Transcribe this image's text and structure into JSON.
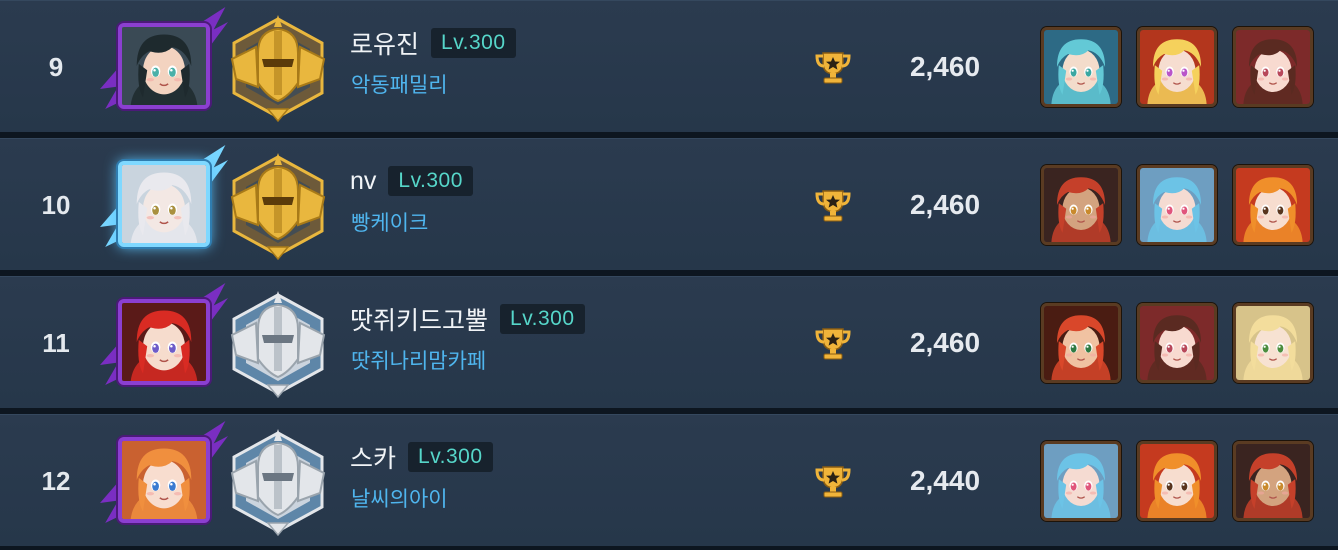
{
  "rows": [
    {
      "rank": "9",
      "name": "로유진",
      "level": "Lv.300",
      "guild": "악동패밀리",
      "score": "2,460",
      "avatar": {
        "frame": "purple",
        "skin": "#f3d3c0",
        "hair": "#1e2a2e",
        "eyes": "#49b0a8",
        "bg": "#3a4a55"
      },
      "badge": "gold",
      "heroes": [
        {
          "name": "hero-portrait-teal",
          "bg": "#2d6a85",
          "hair": "#63c9d6",
          "skin": "#f3dccb",
          "eyes": "#3aa7a2"
        },
        {
          "name": "hero-portrait-blonde",
          "bg": "#b3361d",
          "hair": "#f5d15c",
          "skin": "#f6ddd0",
          "eyes": "#b955c9"
        },
        {
          "name": "hero-portrait-maid",
          "bg": "#7d2a2a",
          "hair": "#5a2a21",
          "skin": "#f8dad0",
          "eyes": "#b8485a"
        }
      ]
    },
    {
      "rank": "10",
      "name": "nv",
      "level": "Lv.300",
      "guild": "빵케이크",
      "score": "2,460",
      "avatar": {
        "frame": "ice",
        "skin": "#f3e8e4",
        "hair": "#e9e9ee",
        "eyes": "#a9903f",
        "bg": "#c9d4de"
      },
      "badge": "gold",
      "heroes": [
        {
          "name": "hero-portrait-pirate",
          "bg": "#3a2420",
          "hair": "#c5402a",
          "skin": "#d3a37f",
          "eyes": "#c98a2c"
        },
        {
          "name": "hero-portrait-blue",
          "bg": "#6e9ec1",
          "hair": "#6cc3e6",
          "skin": "#f5dbd2",
          "eyes": "#e0557c"
        },
        {
          "name": "hero-portrait-orange",
          "bg": "#c53a1f",
          "hair": "#f08f2a",
          "skin": "#f7ddcf",
          "eyes": "#59351e"
        }
      ]
    },
    {
      "rank": "11",
      "name": "땃쥐키드고뿔",
      "level": "Lv.300",
      "guild": "땃쥐나리맘카페",
      "score": "2,460",
      "avatar": {
        "frame": "purple",
        "skin": "#f6dccd",
        "hair": "#d92b23",
        "eyes": "#6d5cc9",
        "bg": "#5a1a18"
      },
      "badge": "silver",
      "heroes": [
        {
          "name": "hero-portrait-redhead",
          "bg": "#4a1c12",
          "hair": "#d9472a",
          "skin": "#f0c2a2",
          "eyes": "#2f7a43"
        },
        {
          "name": "hero-portrait-maid",
          "bg": "#7d2a2a",
          "hair": "#5a2a21",
          "skin": "#f8dad0",
          "eyes": "#b8485a"
        },
        {
          "name": "hero-portrait-elf",
          "bg": "#d7c38a",
          "hair": "#f3dd9c",
          "skin": "#f7e2d2",
          "eyes": "#4c8d3e"
        }
      ]
    },
    {
      "rank": "12",
      "name": "스카",
      "level": "Lv.300",
      "guild": "날씨의아이",
      "score": "2,440",
      "avatar": {
        "frame": "purple",
        "skin": "#f8ddcf",
        "hair": "#f08f3e",
        "eyes": "#3a7bd1",
        "bg": "#c96130"
      },
      "badge": "silver",
      "heroes": [
        {
          "name": "hero-portrait-blue",
          "bg": "#6e9ec1",
          "hair": "#6cc3e6",
          "skin": "#f5dbd2",
          "eyes": "#e0557c"
        },
        {
          "name": "hero-portrait-orange",
          "bg": "#c53a1f",
          "hair": "#f08f2a",
          "skin": "#f7ddcf",
          "eyes": "#59351e"
        },
        {
          "name": "hero-portrait-pirate",
          "bg": "#3a2420",
          "hair": "#c5402a",
          "skin": "#d3a37f",
          "eyes": "#c98a2c"
        }
      ]
    }
  ],
  "colors": {
    "level_text": "#56d6c9",
    "guild_text": "#4fb5ee",
    "trophy_gold": "#f0b43a",
    "badge_gold": "#e9b73e",
    "badge_silver": "#e3e6ea"
  }
}
